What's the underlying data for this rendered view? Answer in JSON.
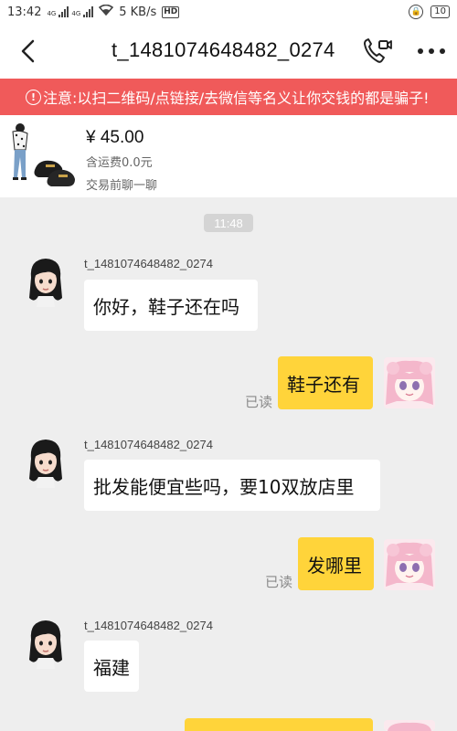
{
  "status_bar": {
    "time": "13:42",
    "net_a": "4G",
    "net_b": "4G",
    "speed": "5 KB/s",
    "hd": "HD",
    "battery": "10"
  },
  "header": {
    "title": "t_1481074648482_0274"
  },
  "warning": {
    "icon": "!",
    "text": "注意:以扫二维码/点链接/去微信等名义让你交钱的都是骗子!"
  },
  "product": {
    "price": "¥ 45.00",
    "shipping": "含运费0.0元",
    "chat_before": "交易前聊一聊"
  },
  "chat": {
    "time": "11:48",
    "read_label": "已读",
    "messages": [
      {
        "side": "in",
        "sender": "t_1481074648482_0274",
        "text": "你好，鞋子还在吗"
      },
      {
        "side": "out",
        "text": "鞋子还有",
        "status": "已读"
      },
      {
        "side": "in",
        "sender": "t_1481074648482_0274",
        "text": "批发能便宜些吗，要10双放店里"
      },
      {
        "side": "out",
        "text": "发哪里",
        "status": "已读"
      },
      {
        "side": "in",
        "sender": "t_1481074648482_0274",
        "text": "福建"
      }
    ]
  },
  "colors": {
    "warning_bg": "#f05a5a",
    "bubble_out": "#ffd43a",
    "bubble_in": "#ffffff",
    "chat_bg": "#eeeeee"
  },
  "icons": {
    "back": "chevron-left-icon",
    "call": "phone-video-icon",
    "more": "more-dots-icon"
  }
}
